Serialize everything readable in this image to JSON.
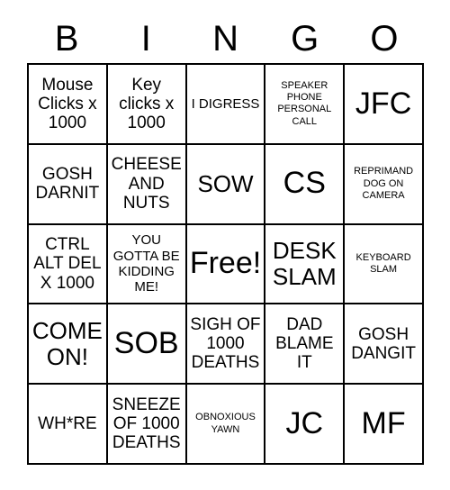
{
  "card": {
    "header_letters": [
      "B",
      "I",
      "N",
      "G",
      "O"
    ],
    "rows": [
      [
        {
          "text": "Mouse Clicks x 1000",
          "size": "m"
        },
        {
          "text": "Key clicks x 1000",
          "size": "m"
        },
        {
          "text": "I DIGRESS",
          "size": "s"
        },
        {
          "text": "SPEAKER PHONE PERSONAL CALL",
          "size": "xs"
        },
        {
          "text": "JFC",
          "size": "xl"
        }
      ],
      [
        {
          "text": "GOSH DARNIT",
          "size": "m"
        },
        {
          "text": "CHEESE AND NUTS",
          "size": "m"
        },
        {
          "text": "SOW",
          "size": "l"
        },
        {
          "text": "CS",
          "size": "xl"
        },
        {
          "text": "REPRIMAND DOG ON CAMERA",
          "size": "xs"
        }
      ],
      [
        {
          "text": "CTRL ALT DEL X 1000",
          "size": "m"
        },
        {
          "text": "YOU GOTTA BE KIDDING ME!",
          "size": "s"
        },
        {
          "text": "Free!",
          "size": "xl"
        },
        {
          "text": "DESK SLAM",
          "size": "l"
        },
        {
          "text": "KEYBOARD SLAM",
          "size": "xs"
        }
      ],
      [
        {
          "text": "COME ON!",
          "size": "l"
        },
        {
          "text": "SOB",
          "size": "xl"
        },
        {
          "text": "SIGH OF 1000 DEATHS",
          "size": "m"
        },
        {
          "text": "DAD BLAME IT",
          "size": "m"
        },
        {
          "text": "GOSH DANGIT",
          "size": "m"
        }
      ],
      [
        {
          "text": "WH*RE",
          "size": "m"
        },
        {
          "text": "SNEEZE OF 1000 DEATHS",
          "size": "m"
        },
        {
          "text": "OBNOXIOUS YAWN",
          "size": "xs"
        },
        {
          "text": "JC",
          "size": "xl"
        },
        {
          "text": "MF",
          "size": "xl"
        }
      ]
    ],
    "free_space": {
      "row": 2,
      "column": 2,
      "label": "Free!"
    },
    "colors": {
      "border": "#000000",
      "text": "#000000",
      "background": "#ffffff"
    }
  }
}
